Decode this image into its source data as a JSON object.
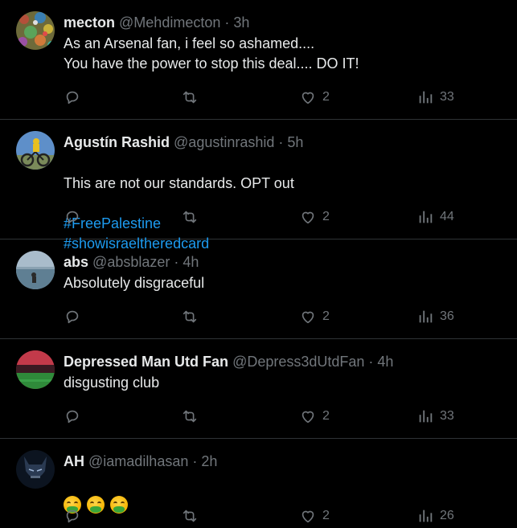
{
  "colors": {
    "background": "#000000",
    "text_primary": "#e7e9ea",
    "text_secondary": "#71767b",
    "link": "#1d9bf0",
    "divider": "#2f3336"
  },
  "tweets": [
    {
      "display_name": "mecton",
      "handle": "@Mehdimecton",
      "time": "3h",
      "text": "As an Arsenal fan, i feel so ashamed....\nYou have the power to stop this deal.... DO IT!",
      "likes": "2",
      "views": "33"
    },
    {
      "display_name": "Agustín Rashid",
      "handle": "@agustinrashid",
      "time": "5h",
      "text": "This are not our standards. OPT out",
      "hashtags": [
        "#FreePalestine",
        "#showisraeltheredcard"
      ],
      "likes": "2",
      "views": "44"
    },
    {
      "display_name": "abs",
      "handle": "@absblazer",
      "time": "4h",
      "text": "Absolutely disgraceful",
      "likes": "2",
      "views": "36"
    },
    {
      "display_name": "Depressed Man Utd Fan",
      "handle": "@Depress3dUtdFan",
      "time": "4h",
      "text": "disgusting club",
      "likes": "2",
      "views": "33"
    },
    {
      "display_name": "AH",
      "handle": "@iamadilhasan",
      "time": "2h",
      "emoji": [
        "face-vomiting",
        "face-vomiting",
        "face-vomiting"
      ],
      "likes": "2",
      "views": "26"
    }
  ],
  "separator": "·",
  "icons": {
    "reply": "reply-icon",
    "retweet": "retweet-icon",
    "like": "heart-icon",
    "views": "views-icon"
  }
}
